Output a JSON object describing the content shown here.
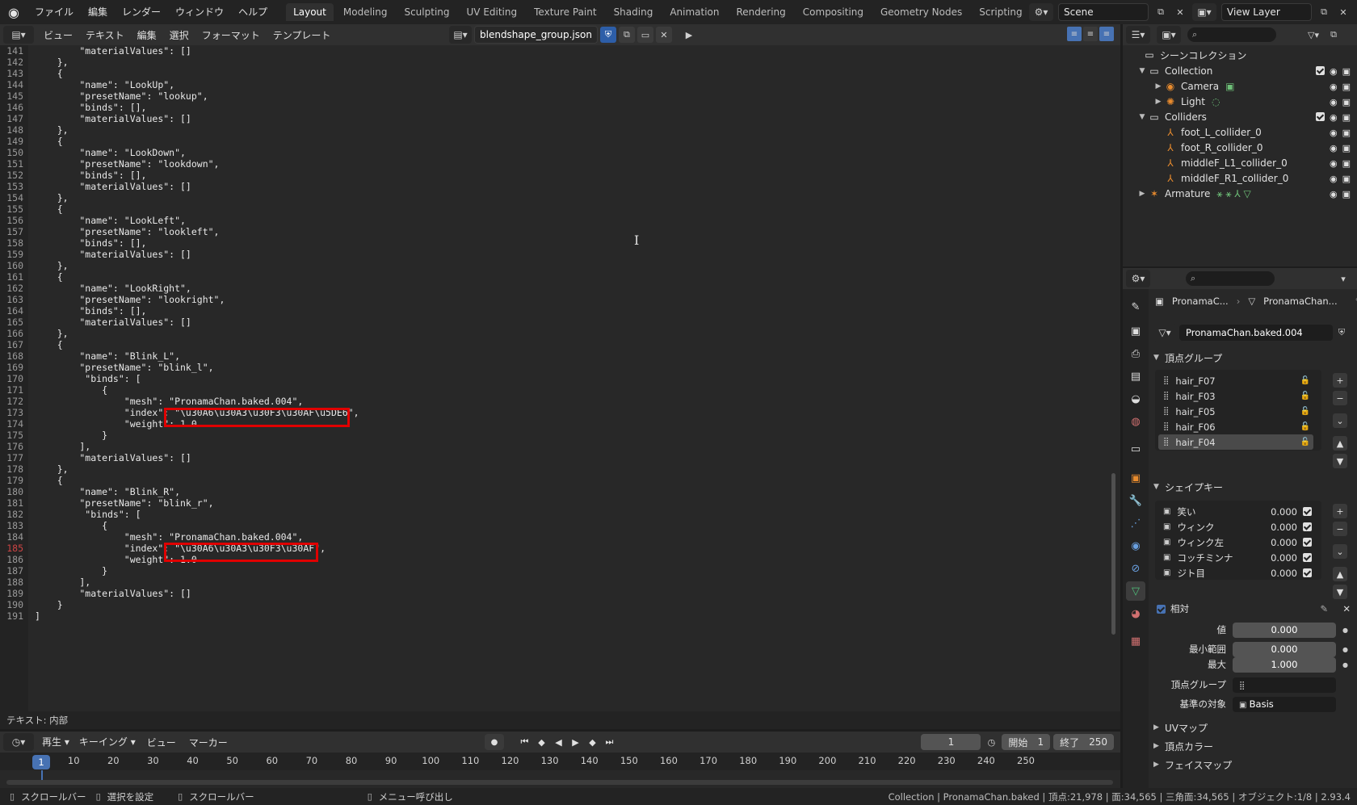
{
  "topbar": {
    "menus": [
      "ファイル",
      "編集",
      "レンダー",
      "ウィンドウ",
      "ヘルプ"
    ],
    "workspaces": [
      "Layout",
      "Modeling",
      "Sculpting",
      "UV Editing",
      "Texture Paint",
      "Shading",
      "Animation",
      "Rendering",
      "Compositing",
      "Geometry Nodes",
      "Scripting"
    ],
    "active_workspace": "Layout",
    "scene": "Scene",
    "view_layer": "View Layer"
  },
  "text_editor": {
    "menus": [
      "ビュー",
      "テキスト",
      "編集",
      "選択",
      "フォーマット",
      "テンプレート"
    ],
    "filename": "blendshape_group.json",
    "footer": "テキスト: 内部",
    "current_line": 185,
    "lines": [
      {
        "n": 141,
        "t": "        \"materialValues\": []"
      },
      {
        "n": 142,
        "t": "    },"
      },
      {
        "n": 143,
        "t": "    {"
      },
      {
        "n": 144,
        "t": "        \"name\": \"LookUp\","
      },
      {
        "n": 145,
        "t": "        \"presetName\": \"lookup\","
      },
      {
        "n": 146,
        "t": "        \"binds\": [],"
      },
      {
        "n": 147,
        "t": "        \"materialValues\": []"
      },
      {
        "n": 148,
        "t": "    },"
      },
      {
        "n": 149,
        "t": "    {"
      },
      {
        "n": 150,
        "t": "        \"name\": \"LookDown\","
      },
      {
        "n": 151,
        "t": "        \"presetName\": \"lookdown\","
      },
      {
        "n": 152,
        "t": "        \"binds\": [],"
      },
      {
        "n": 153,
        "t": "        \"materialValues\": []"
      },
      {
        "n": 154,
        "t": "    },"
      },
      {
        "n": 155,
        "t": "    {"
      },
      {
        "n": 156,
        "t": "        \"name\": \"LookLeft\","
      },
      {
        "n": 157,
        "t": "        \"presetName\": \"lookleft\","
      },
      {
        "n": 158,
        "t": "        \"binds\": [],"
      },
      {
        "n": 159,
        "t": "        \"materialValues\": []"
      },
      {
        "n": 160,
        "t": "    },"
      },
      {
        "n": 161,
        "t": "    {"
      },
      {
        "n": 162,
        "t": "        \"name\": \"LookRight\","
      },
      {
        "n": 163,
        "t": "        \"presetName\": \"lookright\","
      },
      {
        "n": 164,
        "t": "        \"binds\": [],"
      },
      {
        "n": 165,
        "t": "        \"materialValues\": []"
      },
      {
        "n": 166,
        "t": "    },"
      },
      {
        "n": 167,
        "t": "    {"
      },
      {
        "n": 168,
        "t": "        \"name\": \"Blink_L\","
      },
      {
        "n": 169,
        "t": "        \"presetName\": \"blink_l\","
      },
      {
        "n": 170,
        "t": "         \"binds\": ["
      },
      {
        "n": 171,
        "t": "            {"
      },
      {
        "n": 172,
        "t": "                \"mesh\": \"PronamaChan.baked.004\","
      },
      {
        "n": 173,
        "t": "                \"index\": \"\\u30A6\\u30A3\\u30F3\\u30AF\\u5DE6\","
      },
      {
        "n": 174,
        "t": "                \"weight\": 1.0"
      },
      {
        "n": 175,
        "t": "            }"
      },
      {
        "n": 176,
        "t": "        ],"
      },
      {
        "n": 177,
        "t": "        \"materialValues\": []"
      },
      {
        "n": 178,
        "t": "    },"
      },
      {
        "n": 179,
        "t": "    {"
      },
      {
        "n": 180,
        "t": "        \"name\": \"Blink_R\","
      },
      {
        "n": 181,
        "t": "        \"presetName\": \"blink_r\","
      },
      {
        "n": 182,
        "t": "         \"binds\": ["
      },
      {
        "n": 183,
        "t": "            {"
      },
      {
        "n": 184,
        "t": "                \"mesh\": \"PronamaChan.baked.004\","
      },
      {
        "n": 185,
        "t": "                \"index\": \"\\u30A6\\u30A3\\u30F3\\u30AF\","
      },
      {
        "n": 186,
        "t": "                \"weight\": 1.0"
      },
      {
        "n": 187,
        "t": "            }"
      },
      {
        "n": 188,
        "t": "        ],"
      },
      {
        "n": 189,
        "t": "        \"materialValues\": []"
      },
      {
        "n": 190,
        "t": "    }"
      },
      {
        "n": 191,
        "t": "]"
      }
    ]
  },
  "timeline": {
    "menus": [
      "再生",
      "キーイング",
      "ビュー",
      "マーカー"
    ],
    "current_frame": "1",
    "start_label": "開始",
    "start": "1",
    "end_label": "終了",
    "end": "250",
    "ticks": [
      "1",
      "10",
      "20",
      "30",
      "40",
      "50",
      "60",
      "70",
      "80",
      "90",
      "100",
      "110",
      "120",
      "130",
      "140",
      "150",
      "160",
      "170",
      "180",
      "190",
      "200",
      "210",
      "220",
      "230",
      "240",
      "250"
    ]
  },
  "statusbar": {
    "items": [
      "スクロールバー",
      "選択を設定",
      "スクロールバー",
      "メニュー呼び出し"
    ],
    "stats": "Collection | PronamaChan.baked | 頂点:21,978 | 面:34,565 | 三角面:34,565 | オブジェクト:1/8 | 2.93.4"
  },
  "outliner": {
    "root": "シーンコレクション",
    "rows": [
      {
        "label": "Collection",
        "indent": 1,
        "icon": "collection-icon",
        "twisty": "▼",
        "check": true
      },
      {
        "label": "Camera",
        "indent": 2,
        "icon": "camera-icon",
        "twisty": "▶",
        "extras": "camera-data-icon"
      },
      {
        "label": "Light",
        "indent": 2,
        "icon": "light-icon",
        "twisty": "▶",
        "extras": "light-data-icon"
      },
      {
        "label": "Colliders",
        "indent": 1,
        "icon": "collection-icon",
        "twisty": "▼",
        "check": true
      },
      {
        "label": "foot_L_collider_0",
        "indent": 2,
        "icon": "empty-icon",
        "twisty": ""
      },
      {
        "label": "foot_R_collider_0",
        "indent": 2,
        "icon": "empty-icon",
        "twisty": ""
      },
      {
        "label": "middleF_L1_collider_0",
        "indent": 2,
        "icon": "empty-icon",
        "twisty": ""
      },
      {
        "label": "middleF_R1_collider_0",
        "indent": 2,
        "icon": "empty-icon",
        "twisty": ""
      },
      {
        "label": "Armature",
        "indent": 1,
        "icon": "armature-icon",
        "twisty": "▶",
        "extras": "armature-extras-icons"
      }
    ]
  },
  "properties": {
    "breadcrumb_object": "PronamaC...",
    "breadcrumb_data": "PronamaChan...",
    "mesh_datablock": "PronamaChan.baked.004",
    "vertex_groups_title": "頂点グループ",
    "vertex_groups": [
      "hair_F07",
      "hair_F03",
      "hair_F05",
      "hair_F06",
      "hair_F04"
    ],
    "vertex_groups_selected": 4,
    "shape_keys_title": "シェイプキー",
    "shape_keys": [
      {
        "name": "笑い",
        "value": "0.000"
      },
      {
        "name": "ウィンク",
        "value": "0.000"
      },
      {
        "name": "ウィンク左",
        "value": "0.000"
      },
      {
        "name": "コッチミンナ",
        "value": "0.000"
      },
      {
        "name": "ジト目",
        "value": "0.000"
      }
    ],
    "relative_label": "相対",
    "value_label": "値",
    "value": "0.000",
    "range_min_label": "最小範囲",
    "range_min": "0.000",
    "max_label": "最大",
    "max": "1.000",
    "vgroup_label": "頂点グループ",
    "vgroup_value": "",
    "relative_to_label": "基準の対象",
    "relative_to": "Basis",
    "collapsed_panels": [
      "UVマップ",
      "頂点カラー",
      "フェイスマップ"
    ]
  }
}
